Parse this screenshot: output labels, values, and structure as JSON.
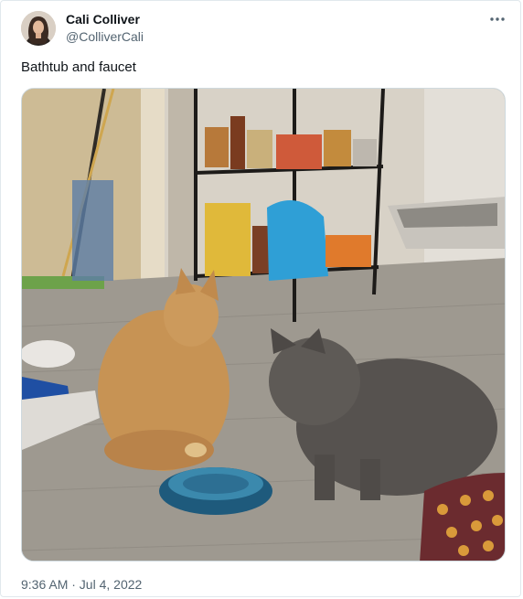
{
  "author": {
    "name": "Cali Colliver",
    "handle": "@ColliverCali",
    "avatar_icon": "profile-photo"
  },
  "more_icon": "ellipsis-icon",
  "tweet": {
    "text": "Bathtub and faucet",
    "timestamp": "9:36 AM · Jul 4, 2022"
  },
  "media": {
    "description_icon": "photo"
  },
  "colors": {
    "text_primary": "#0f1419",
    "text_secondary": "#536471",
    "border": "#e1e8ed"
  }
}
